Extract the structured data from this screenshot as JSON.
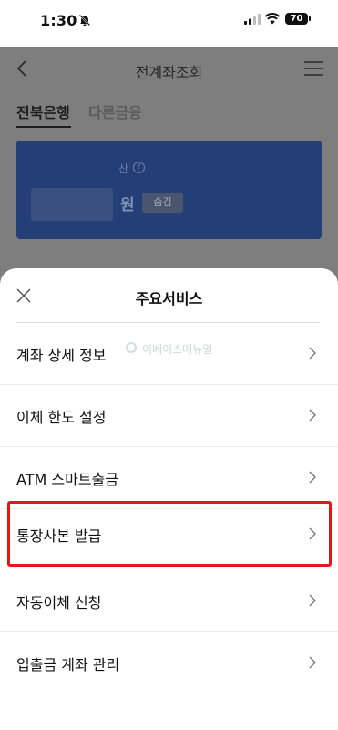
{
  "status_bar": {
    "time": "1:30",
    "battery": "70"
  },
  "header": {
    "title": "전계좌조회"
  },
  "tabs": [
    {
      "label": "전북은행",
      "active": true
    },
    {
      "label": "다른금융",
      "active": false
    }
  ],
  "account_card": {
    "label_fragment": "산",
    "currency": "원",
    "hide_button": "숨김"
  },
  "sheet": {
    "title": "주요서비스",
    "watermark": "이베이스매뉴얼",
    "items": [
      {
        "label": "계좌 상세 정보"
      },
      {
        "label": "이체 한도 설정"
      },
      {
        "label": "ATM 스마트출금"
      },
      {
        "label": "통장사본 발급",
        "highlighted": true
      },
      {
        "label": "자동이체 신청"
      },
      {
        "label": "입출금 계좌 관리"
      }
    ]
  },
  "colors": {
    "highlight": "#e8141b",
    "card": "#233f75"
  },
  "icons": [
    "bell-off-icon",
    "signal-icon",
    "wifi-icon",
    "battery-icon",
    "back-arrow-icon",
    "menu-icon",
    "info-icon",
    "close-icon",
    "chevron-right-icon"
  ]
}
